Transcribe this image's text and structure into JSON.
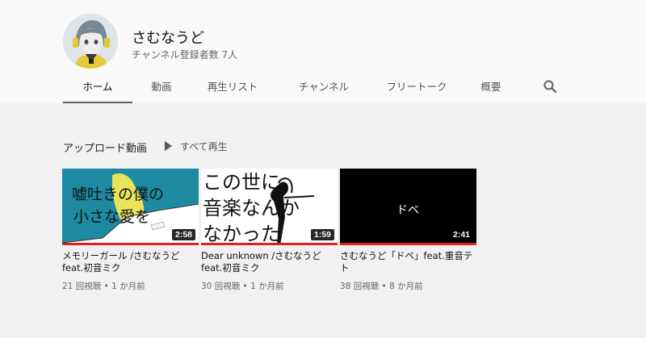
{
  "channel": {
    "name": "さむなうど",
    "subscribers": "チャンネル登録者数 7人"
  },
  "tabs": [
    {
      "label": "ホーム"
    },
    {
      "label": "動画"
    },
    {
      "label": "再生リスト"
    },
    {
      "label": "チャンネル"
    },
    {
      "label": "フリートーク"
    },
    {
      "label": "概要"
    }
  ],
  "section": {
    "title": "アップロード動画",
    "play_all": "すべて再生"
  },
  "videos": [
    {
      "thumb_text_1": "嘘吐きの僕の",
      "thumb_text_2": "小さな愛を",
      "duration": "2:58",
      "title": "メモリーガール /さむなうど feat.初音ミク",
      "views": "21 回視聴",
      "age": "1 か月前"
    },
    {
      "thumb_text_1": "この世に",
      "thumb_text_2": "音楽なんか",
      "thumb_text_3": "なかった",
      "duration": "1:59",
      "title": "Dear unknown /さむなうど feat.初音ミク",
      "views": "30 回視聴",
      "age": "1 か月前"
    },
    {
      "thumb_text_1": "ドベ",
      "duration": "2:41",
      "title": "さむなうど「ドベ」feat.重音テト",
      "views": "38 回視聴",
      "age": "8 か月前"
    }
  ],
  "colors": {
    "accent": "#e02020",
    "thumb1_bg": "#1e8aa1",
    "thumb1_yellow": "#e8e35a"
  },
  "icons": {
    "search": "search-icon",
    "play": "play-icon"
  }
}
